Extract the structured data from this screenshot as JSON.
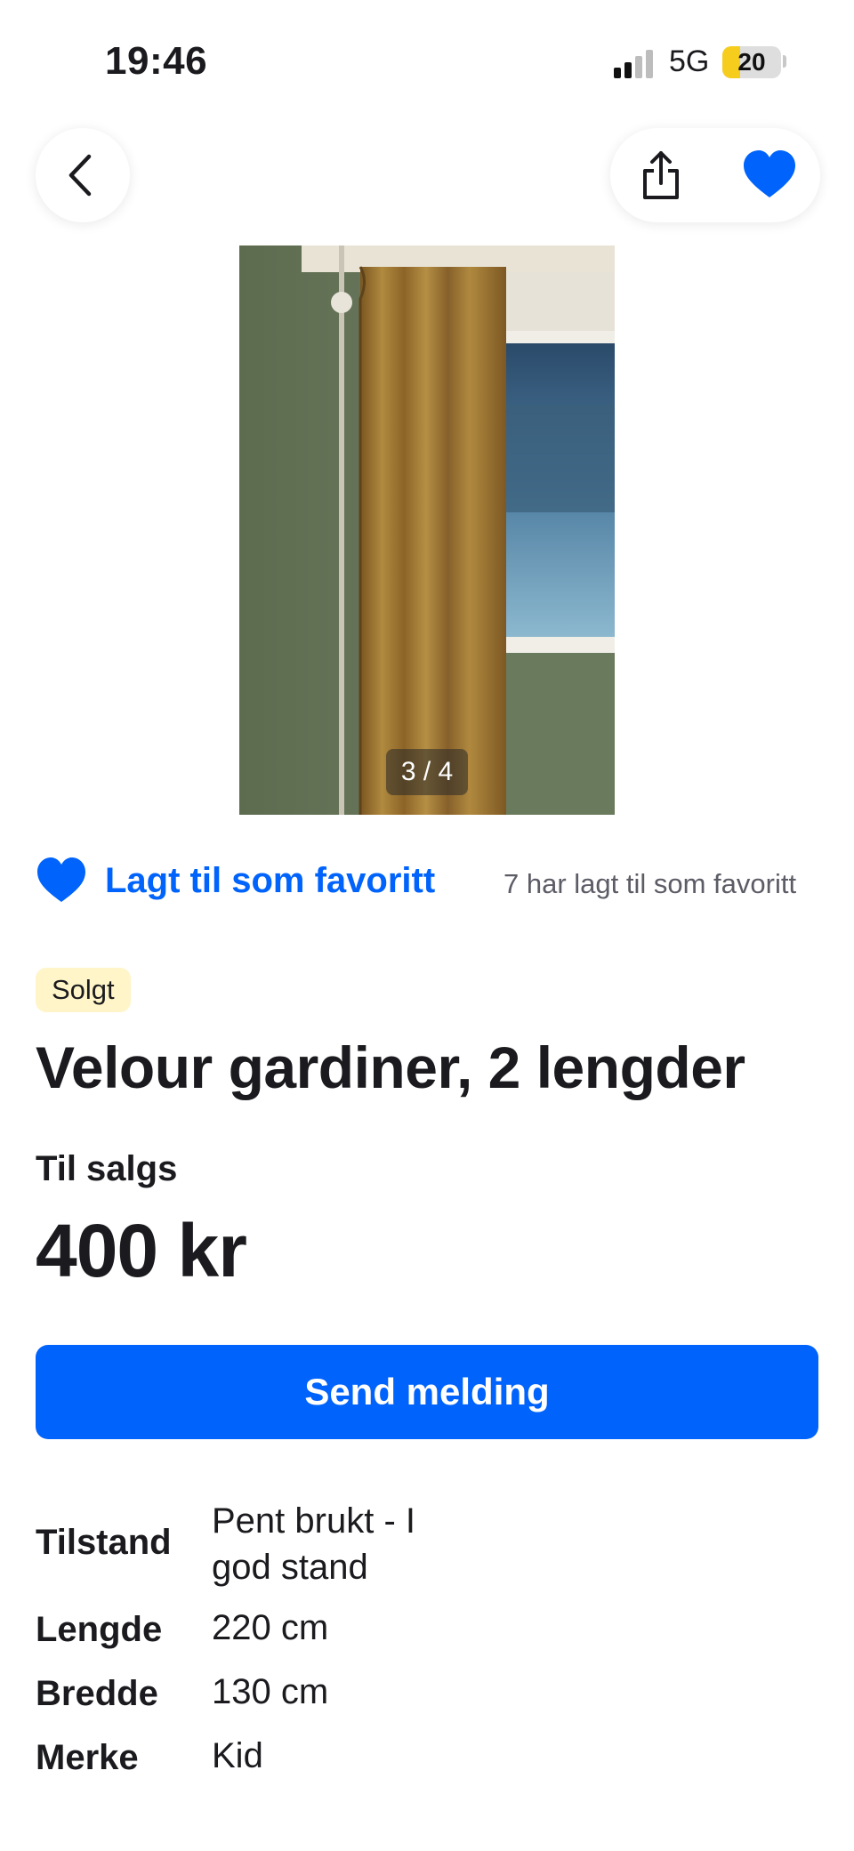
{
  "status_bar": {
    "time": "19:46",
    "network": "5G",
    "battery": "20"
  },
  "nav": {
    "back_icon": "chevron-left-icon",
    "share_icon": "share-icon",
    "favorite_icon": "heart-icon"
  },
  "gallery": {
    "counter": "3 / 4"
  },
  "favorite": {
    "label": "Lagt til som favoritt",
    "count_text": "7 har lagt til som favoritt"
  },
  "listing": {
    "status_badge": "Solgt",
    "title": "Velour gardiner, 2 lengder",
    "sale_type": "Til salgs",
    "price": "400 kr",
    "send_button": "Send melding"
  },
  "specs": [
    {
      "key": "Tilstand",
      "value_line1": "Pent brukt - I",
      "value_line2": "god stand"
    },
    {
      "key": "Lengde",
      "value": "220 cm"
    },
    {
      "key": "Bredde",
      "value": "130 cm"
    },
    {
      "key": "Merke",
      "value": "Kid"
    }
  ],
  "colors": {
    "accent": "#0063fb",
    "badge_bg": "#fff5c8",
    "text": "#1b1b1f",
    "muted": "#5c5c66"
  }
}
